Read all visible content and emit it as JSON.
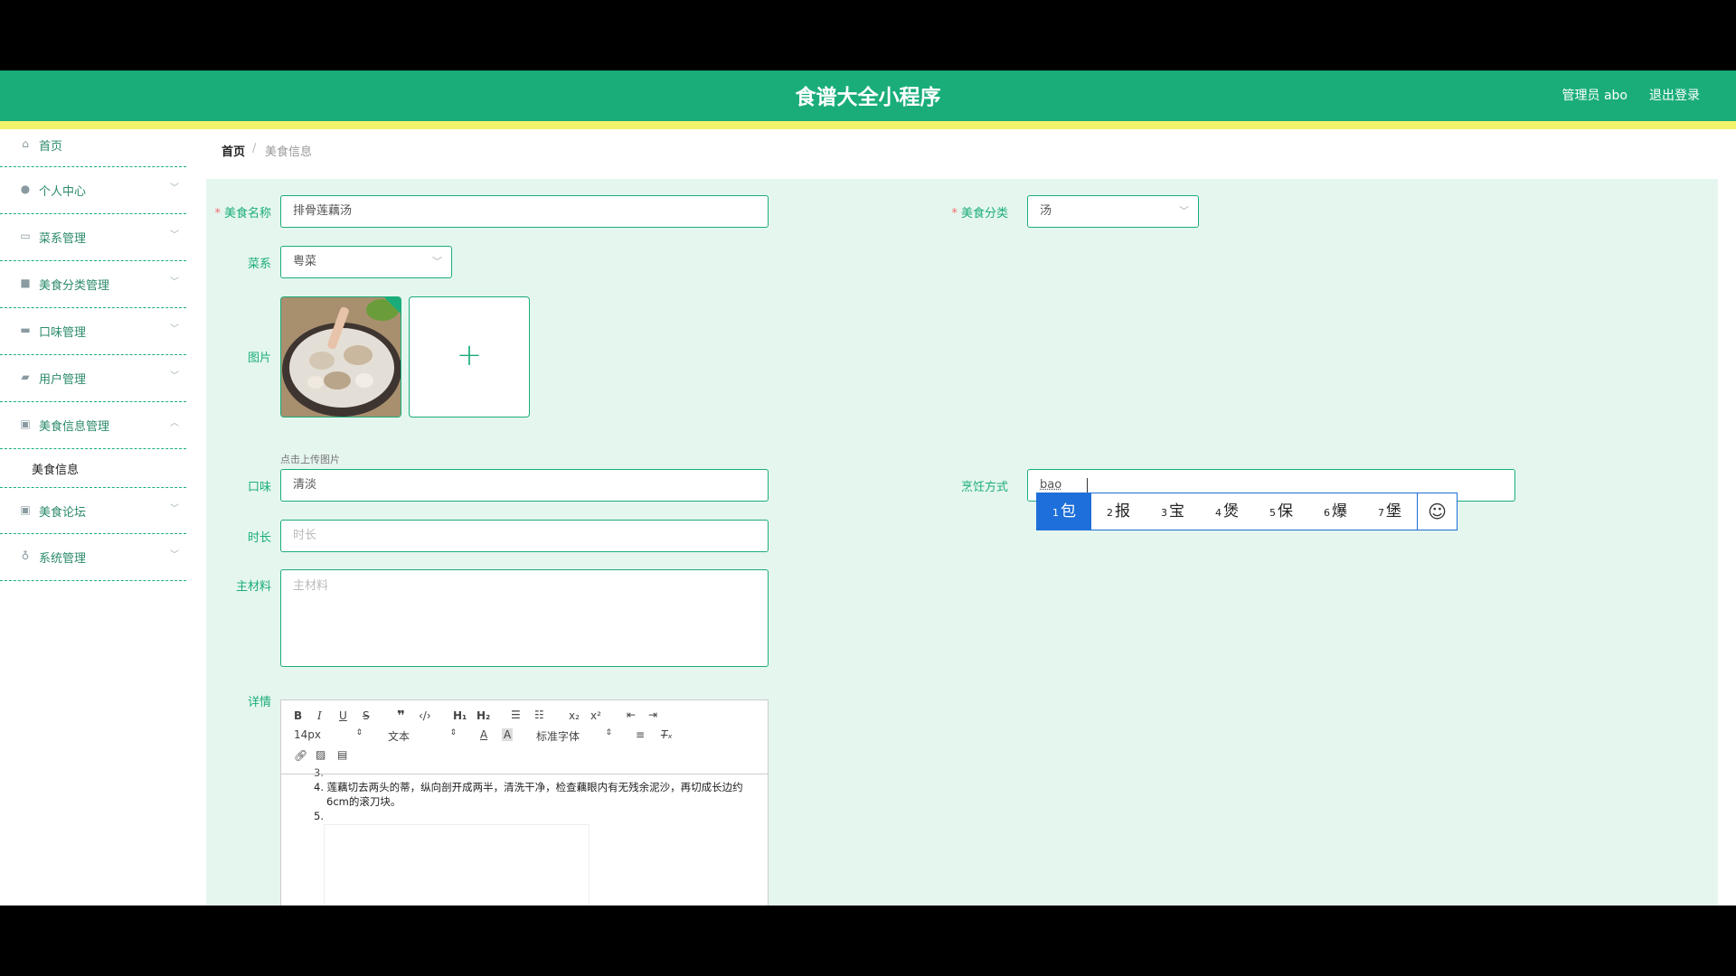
{
  "header": {
    "title": "食谱大全小程序",
    "admin": "管理员 abo",
    "logout": "退出登录"
  },
  "sidebar": {
    "items": [
      {
        "label": "首页",
        "icon": "home-icon"
      },
      {
        "label": "个人中心",
        "icon": "user-icon"
      },
      {
        "label": "菜系管理",
        "icon": "message-icon"
      },
      {
        "label": "美食分类管理",
        "icon": "chart-icon"
      },
      {
        "label": "口味管理",
        "icon": "monitor-icon"
      },
      {
        "label": "用户管理",
        "icon": "briefcase-icon"
      },
      {
        "label": "美食信息管理",
        "icon": "clipboard-icon"
      },
      {
        "label": "美食论坛",
        "icon": "clipboard-icon"
      },
      {
        "label": "系统管理",
        "icon": "mic-icon"
      }
    ],
    "submenu_label": "美食信息"
  },
  "breadcrumb": {
    "home": "首页",
    "separator": "/",
    "current": "美食信息"
  },
  "form": {
    "name_label": "美食名称",
    "name_value": "排骨莲藕汤",
    "category_label": "美食分类",
    "category_value": "汤",
    "cuisine_label": "菜系",
    "cuisine_value": "粤菜",
    "image_label": "图片",
    "upload_tip": "点击上传图片",
    "taste_label": "口味",
    "taste_value": "清淡",
    "cooking_label": "烹饪方式",
    "cooking_value": "bao",
    "duration_label": "时长",
    "duration_placeholder": "时长",
    "ingredients_label": "主材料",
    "ingredients_placeholder": "主材料",
    "detail_label": "详情"
  },
  "editor": {
    "font_size": "14px",
    "paragraph": "文本",
    "font_family": "标准字体",
    "lines": [
      "3.",
      "4. 莲藕切去两头的蒂，纵向剖开成两半，清洗干净，检查藕眼内有无残余泥沙，再切成长边约",
      "6cm的滚刀块。",
      "5."
    ]
  },
  "ime": {
    "candidates": [
      {
        "num": "1",
        "char": "包"
      },
      {
        "num": "2",
        "char": "报"
      },
      {
        "num": "3",
        "char": "宝"
      },
      {
        "num": "4",
        "char": "煲"
      },
      {
        "num": "5",
        "char": "保"
      },
      {
        "num": "6",
        "char": "爆"
      },
      {
        "num": "7",
        "char": "堡"
      }
    ],
    "emoji": "☺"
  },
  "colors": {
    "primary": "#1aad7a",
    "accent_bar": "#f3f36b",
    "panel_bg": "#e5f6ef",
    "ime_blue": "#1e6fd9"
  }
}
